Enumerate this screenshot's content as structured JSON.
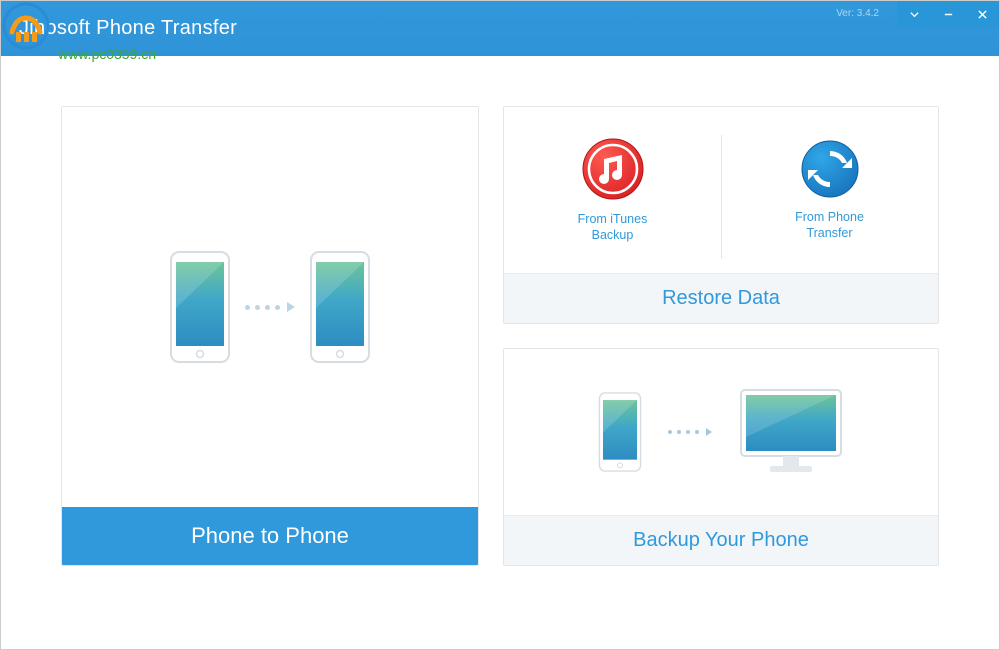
{
  "titlebar": {
    "app_title": "Jihosoft Phone Transfer",
    "version": "Ver: 3.4.2"
  },
  "watermark": {
    "url_text": "www.pc0359.cn"
  },
  "cards": {
    "phone_to_phone": {
      "title": "Phone to Phone"
    },
    "restore": {
      "title": "Restore Data",
      "from_itunes_line1": "From iTunes",
      "from_itunes_line2": "Backup",
      "from_transfer_line1": "From Phone",
      "from_transfer_line2": "Transfer"
    },
    "backup": {
      "title": "Backup Your Phone"
    }
  }
}
